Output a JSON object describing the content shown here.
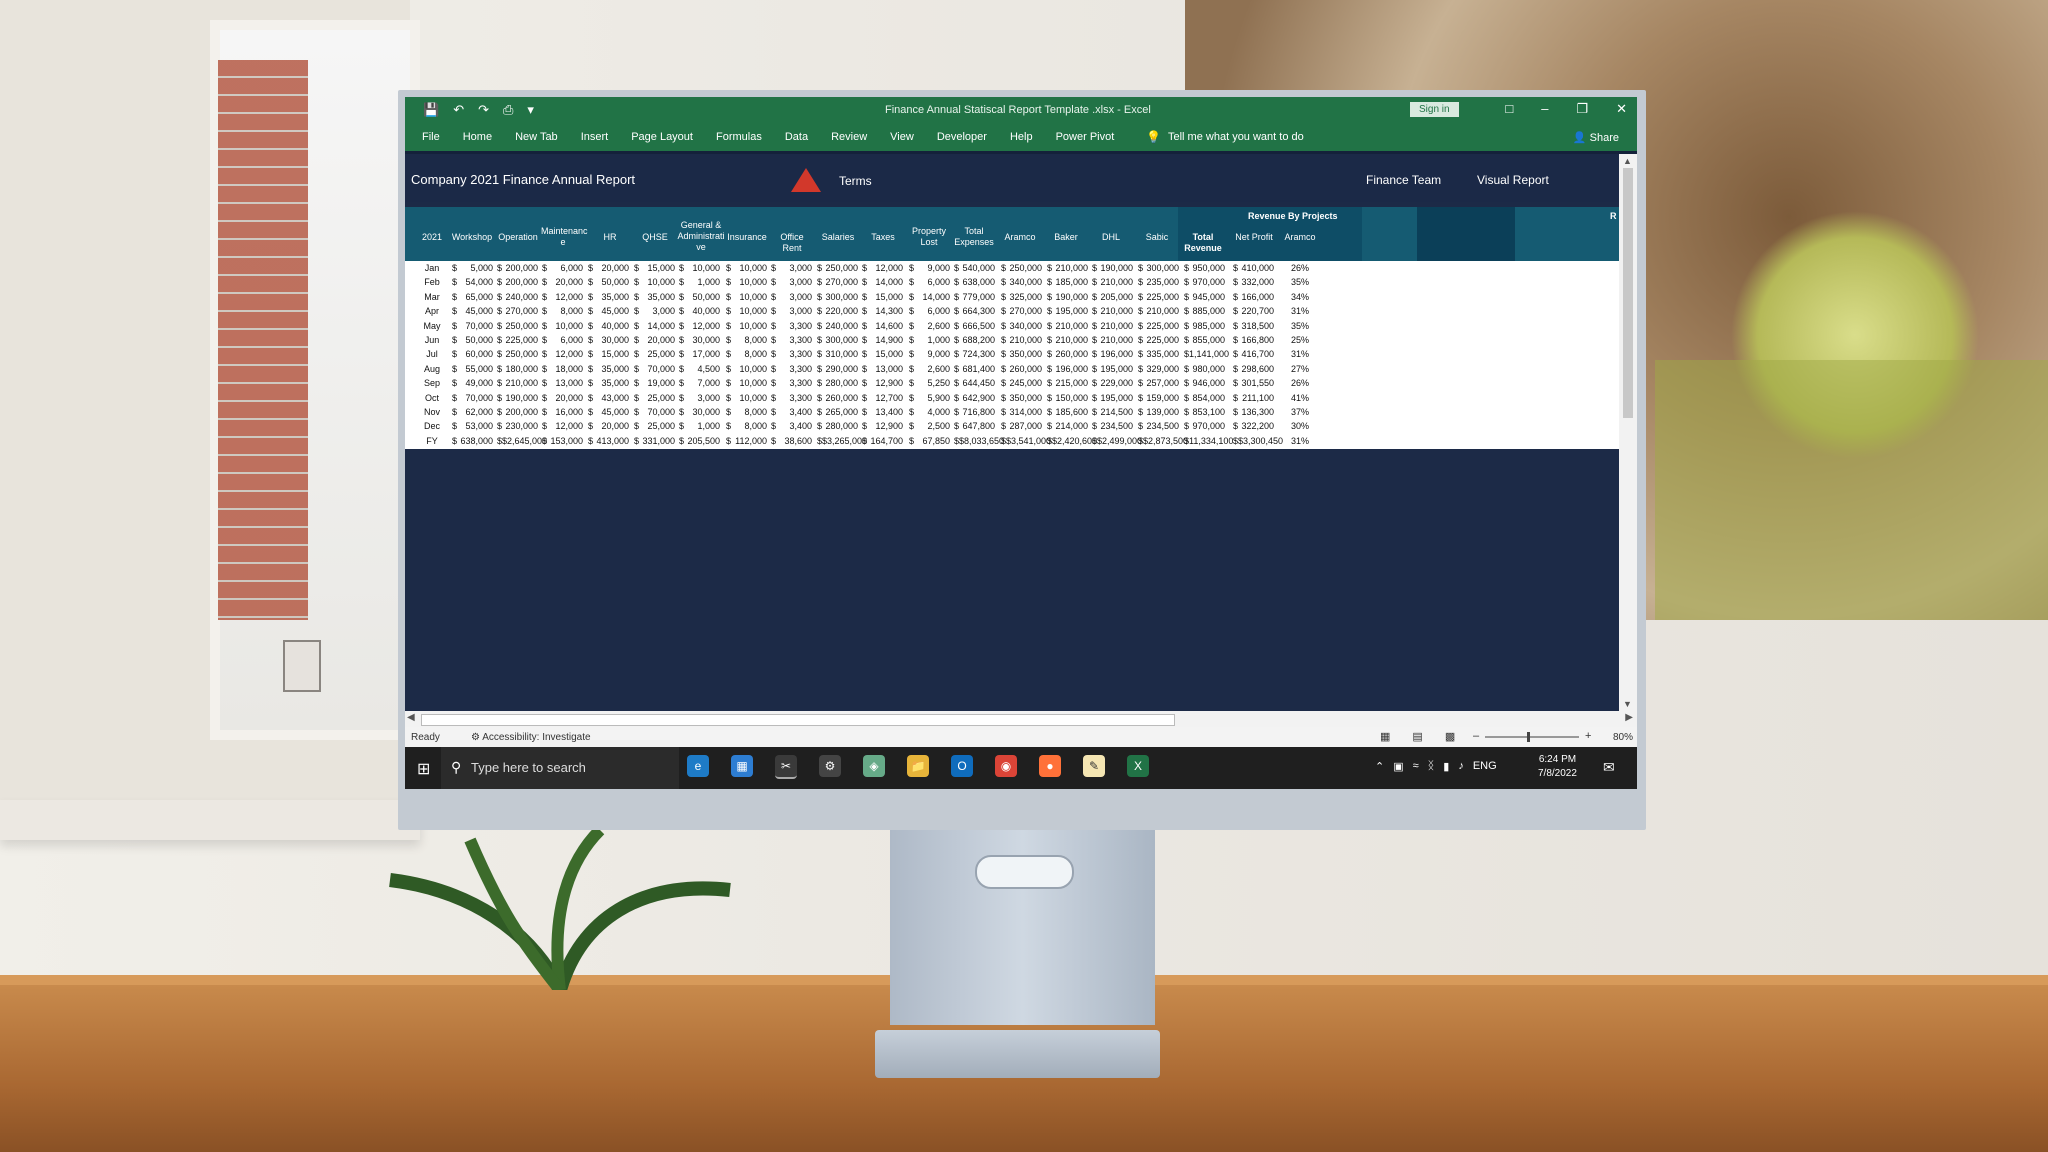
{
  "window": {
    "title": "Finance Annual Statiscal Report Template .xlsx  -  Excel",
    "sign_in": "Sign in"
  },
  "ribbon": {
    "tabs": [
      "File",
      "Home",
      "New Tab",
      "Insert",
      "Page Layout",
      "Formulas",
      "Data",
      "Review",
      "View",
      "Developer",
      "Help",
      "Power Pivot"
    ],
    "tell_me": "Tell me what you want to do",
    "share": "Share"
  },
  "sheet_header": {
    "report_title": "Company 2021 Finance Annual Report",
    "terms": "Terms",
    "finance_team": "Finance Team",
    "visual_report": "Visual Report",
    "revenue_group": "Revenue By Projects",
    "r_cut": "R"
  },
  "columns": [
    "2021",
    "Workshop",
    "Operation",
    "Maintenanc\ne",
    "HR",
    "QHSE",
    "General &\nAdministrati\nve",
    "Insurance",
    "Office Rent",
    "Salaries",
    "Taxes",
    "Property\nLost",
    "Total\nExpenses",
    "Aramco",
    "Baker",
    "DHL",
    "Sabic",
    "Total Revenue",
    "Net Profit",
    "Aramco"
  ],
  "rows": [
    [
      "Jan",
      "5,000",
      "200,000",
      "6,000",
      "20,000",
      "15,000",
      "10,000",
      "10,000",
      "3,000",
      "250,000",
      "12,000",
      "9,000",
      "540,000",
      "250,000",
      "210,000",
      "190,000",
      "300,000",
      "950,000",
      "410,000",
      "26%"
    ],
    [
      "Feb",
      "54,000",
      "200,000",
      "20,000",
      "50,000",
      "10,000",
      "1,000",
      "10,000",
      "3,000",
      "270,000",
      "14,000",
      "6,000",
      "638,000",
      "340,000",
      "185,000",
      "210,000",
      "235,000",
      "970,000",
      "332,000",
      "35%"
    ],
    [
      "Mar",
      "65,000",
      "240,000",
      "12,000",
      "35,000",
      "35,000",
      "50,000",
      "10,000",
      "3,000",
      "300,000",
      "15,000",
      "14,000",
      "779,000",
      "325,000",
      "190,000",
      "205,000",
      "225,000",
      "945,000",
      "166,000",
      "34%"
    ],
    [
      "Apr",
      "45,000",
      "270,000",
      "8,000",
      "45,000",
      "3,000",
      "40,000",
      "10,000",
      "3,000",
      "220,000",
      "14,300",
      "6,000",
      "664,300",
      "270,000",
      "195,000",
      "210,000",
      "210,000",
      "885,000",
      "220,700",
      "31%"
    ],
    [
      "May",
      "70,000",
      "250,000",
      "10,000",
      "40,000",
      "14,000",
      "12,000",
      "10,000",
      "3,300",
      "240,000",
      "14,600",
      "2,600",
      "666,500",
      "340,000",
      "210,000",
      "210,000",
      "225,000",
      "985,000",
      "318,500",
      "35%"
    ],
    [
      "Jun",
      "50,000",
      "225,000",
      "6,000",
      "30,000",
      "20,000",
      "30,000",
      "8,000",
      "3,300",
      "300,000",
      "14,900",
      "1,000",
      "688,200",
      "210,000",
      "210,000",
      "210,000",
      "225,000",
      "855,000",
      "166,800",
      "25%"
    ],
    [
      "Jul",
      "60,000",
      "250,000",
      "12,000",
      "15,000",
      "25,000",
      "17,000",
      "8,000",
      "3,300",
      "310,000",
      "15,000",
      "9,000",
      "724,300",
      "350,000",
      "260,000",
      "196,000",
      "335,000",
      "1,141,000",
      "416,700",
      "31%"
    ],
    [
      "Aug",
      "55,000",
      "180,000",
      "18,000",
      "35,000",
      "70,000",
      "4,500",
      "10,000",
      "3,300",
      "290,000",
      "13,000",
      "2,600",
      "681,400",
      "260,000",
      "196,000",
      "195,000",
      "329,000",
      "980,000",
      "298,600",
      "27%"
    ],
    [
      "Sep",
      "49,000",
      "210,000",
      "13,000",
      "35,000",
      "19,000",
      "7,000",
      "10,000",
      "3,300",
      "280,000",
      "12,900",
      "5,250",
      "644,450",
      "245,000",
      "215,000",
      "229,000",
      "257,000",
      "946,000",
      "301,550",
      "26%"
    ],
    [
      "Oct",
      "70,000",
      "190,000",
      "20,000",
      "43,000",
      "25,000",
      "3,000",
      "10,000",
      "3,300",
      "260,000",
      "12,700",
      "5,900",
      "642,900",
      "350,000",
      "150,000",
      "195,000",
      "159,000",
      "854,000",
      "211,100",
      "41%"
    ],
    [
      "Nov",
      "62,000",
      "200,000",
      "16,000",
      "45,000",
      "70,000",
      "30,000",
      "8,000",
      "3,400",
      "265,000",
      "13,400",
      "4,000",
      "716,800",
      "314,000",
      "185,600",
      "214,500",
      "139,000",
      "853,100",
      "136,300",
      "37%"
    ],
    [
      "Dec",
      "53,000",
      "230,000",
      "12,000",
      "20,000",
      "25,000",
      "1,000",
      "8,000",
      "3,400",
      "280,000",
      "12,900",
      "2,500",
      "647,800",
      "287,000",
      "214,000",
      "234,500",
      "234,500",
      "970,000",
      "322,200",
      "30%"
    ],
    [
      "FY",
      "638,000",
      "$2,645,000",
      "153,000",
      "413,000",
      "331,000",
      "205,500",
      "112,000",
      "38,600",
      "$3,265,000",
      "164,700",
      "67,850",
      "$8,033,650",
      "$3,541,000",
      "$2,420,600",
      "$2,499,000",
      "$2,873,500",
      "11,334,100",
      "$3,300,450",
      "31%"
    ]
  ],
  "status": {
    "ready": "Ready",
    "accessibility": "Accessibility: Investigate",
    "zoom": "80%"
  },
  "taskbar": {
    "search_placeholder": "Type here to search",
    "lang": "ENG",
    "time": "6:24 PM",
    "date": "7/8/2022"
  }
}
